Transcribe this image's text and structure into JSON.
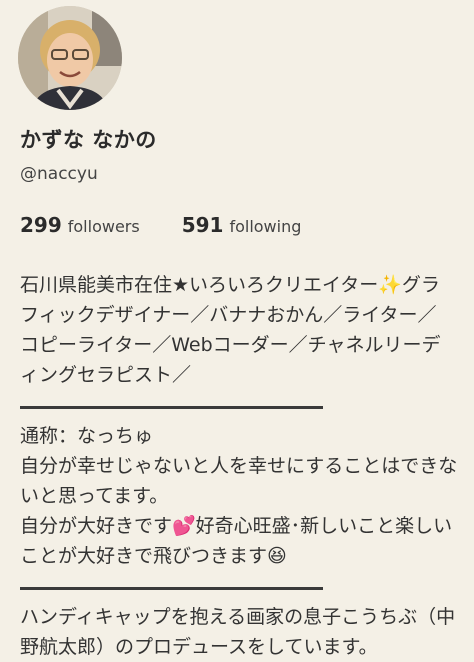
{
  "profile": {
    "name": "かずな なかの",
    "handle": "@naccyu",
    "followers_count": "299",
    "followers_label": "followers",
    "following_count": "591",
    "following_label": "following"
  },
  "bio": {
    "paragraph1": "石川県能美市在住★いろいろクリエイター✨グラフィックデザイナー／バナナおかん／ライター／コピーライター／Webコーダー／チャネルリーディングセラピスト／",
    "line_nickname": "通称：なっちゅ",
    "line_happiness": "自分が幸せじゃないと人を幸せにすることはできないと思ってます。",
    "line_love": "自分が大好きです💕好奇心旺盛･新しいこと楽しいことが大好きで飛びつきます😆",
    "paragraph3": "ハンディキャップを抱える画家の息子こうちぶ（中野航太郎）のプロデュースをしています。"
  }
}
